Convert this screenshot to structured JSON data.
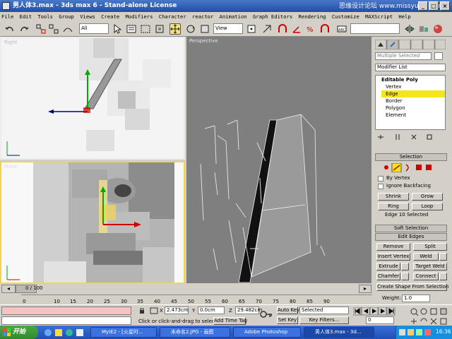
{
  "window": {
    "title": "男人体3.max - 3ds max 6 - Stand-alone License",
    "watermark": "思缘设计论坛 www.missyuan.com",
    "btn_min": "_",
    "btn_max": "□",
    "btn_close": "×"
  },
  "menu": [
    "File",
    "Edit",
    "Tools",
    "Group",
    "Views",
    "Create",
    "Modifiers",
    "Character",
    "reactor",
    "Animation",
    "Graph Editors",
    "Rendering",
    "Customize",
    "MAXScript",
    "Help"
  ],
  "toolbar": {
    "selection_filter": "All",
    "reference_coord": "View",
    "named_selection": ""
  },
  "viewports": {
    "top_left": "Right",
    "bottom_left": "Front",
    "main": "Perspective"
  },
  "panel": {
    "object_name": "Multiple Selected",
    "modifier_list": "Modifier List",
    "stack_title": "Editable Poly",
    "stack_items": [
      "Vertex",
      "Edge",
      "Border",
      "Polygon",
      "Element"
    ],
    "selection": {
      "header": "Selection",
      "by_vertex": "By Vertex",
      "ignore_backfacing": "Ignore Backfacing",
      "shrink": "Shrink",
      "grow": "Grow",
      "ring": "Ring",
      "loop": "Loop",
      "status": "Edge 10 Selected"
    },
    "soft_selection": "Soft Selection",
    "edit_edges": {
      "header": "Edit Edges",
      "remove": "Remove",
      "split": "Split",
      "insert_vertex": "Insert Vertex",
      "weld": "Weld",
      "extrude": "Extrude",
      "target_weld": "Target Weld",
      "chamfer": "Chamfer",
      "connect": "Connect",
      "create_shape": "Create Shape From Selection",
      "weight_label": "Weight:",
      "weight_value": "1.0"
    }
  },
  "timeline": {
    "frame_display": "0 / 100",
    "ticks": [
      "10",
      "15",
      "20",
      "25",
      "30",
      "35",
      "40",
      "45",
      "50",
      "55",
      "60",
      "65",
      "70",
      "75",
      "80",
      "85",
      "90"
    ],
    "tick_zero": "0"
  },
  "status": {
    "prompt": "Click or click-and-drag to select ob",
    "add_time_tag": "Add Time Tag",
    "x_label": "X",
    "x_value": "2.473cm",
    "y_label": "Y",
    "y_value": "0.0cm",
    "z_label": "Z",
    "z_value": "29.482cm",
    "auto_key": "Auto Key",
    "set_key": "Set Key",
    "key_mode": "Selected",
    "key_filters": "Key Filters...",
    "frame_field": "0"
  },
  "taskbar": {
    "start": "开始",
    "tasks": [
      "MyIE2 - [火星时...",
      "未命名2.JPG - 画图",
      "Adobe Photoshop",
      "男人体3.max - 3d..."
    ],
    "clock": "16:36"
  }
}
